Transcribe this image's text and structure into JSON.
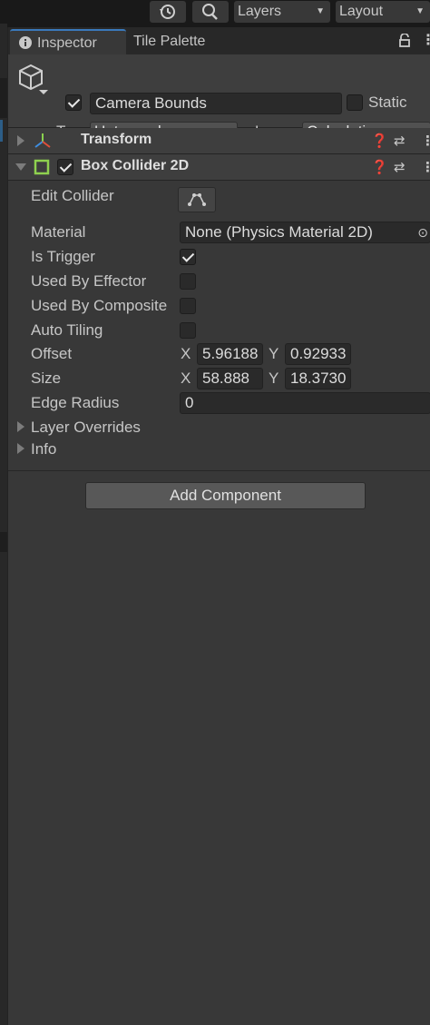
{
  "toolbar": {
    "history_icon": "history-icon",
    "search_icon": "search-icon",
    "layers_label": "Layers",
    "layout_label": "Layout"
  },
  "tabs": {
    "inspector": "Inspector",
    "tile_palette": "Tile Palette"
  },
  "object": {
    "name": "Camera Bounds",
    "active": true,
    "static_label": "Static",
    "static": false,
    "tag_label": "Tag",
    "tag_value": "Untagged",
    "layer_label": "Layer",
    "layer_value": "Calculations"
  },
  "components": {
    "transform": {
      "title": "Transform",
      "expanded": false
    },
    "box_collider": {
      "title": "Box Collider 2D",
      "enabled": true,
      "expanded": true,
      "edit_collider_label": "Edit Collider",
      "material_label": "Material",
      "material_value": "None (Physics Material 2D)",
      "is_trigger_label": "Is Trigger",
      "is_trigger": true,
      "used_by_effector_label": "Used By Effector",
      "used_by_effector": false,
      "used_by_composite_label": "Used By Composite",
      "used_by_composite": false,
      "auto_tiling_label": "Auto Tiling",
      "auto_tiling": false,
      "offset_label": "Offset",
      "offset_x": "5.96188",
      "offset_y": "0.92933",
      "size_label": "Size",
      "size_x": "58.888",
      "size_y": "18.3730",
      "edge_radius_label": "Edge Radius",
      "edge_radius": "0",
      "axis_x": "X",
      "axis_y": "Y",
      "layer_overrides_label": "Layer Overrides",
      "info_label": "Info"
    }
  },
  "add_component_label": "Add Component",
  "colors": {
    "panel_bg": "#383838",
    "header_bg": "#3e3e3e",
    "field_bg": "#2a2a2a",
    "accent_tab": "#3a79bb",
    "collider_icon": "#8fd14f"
  }
}
